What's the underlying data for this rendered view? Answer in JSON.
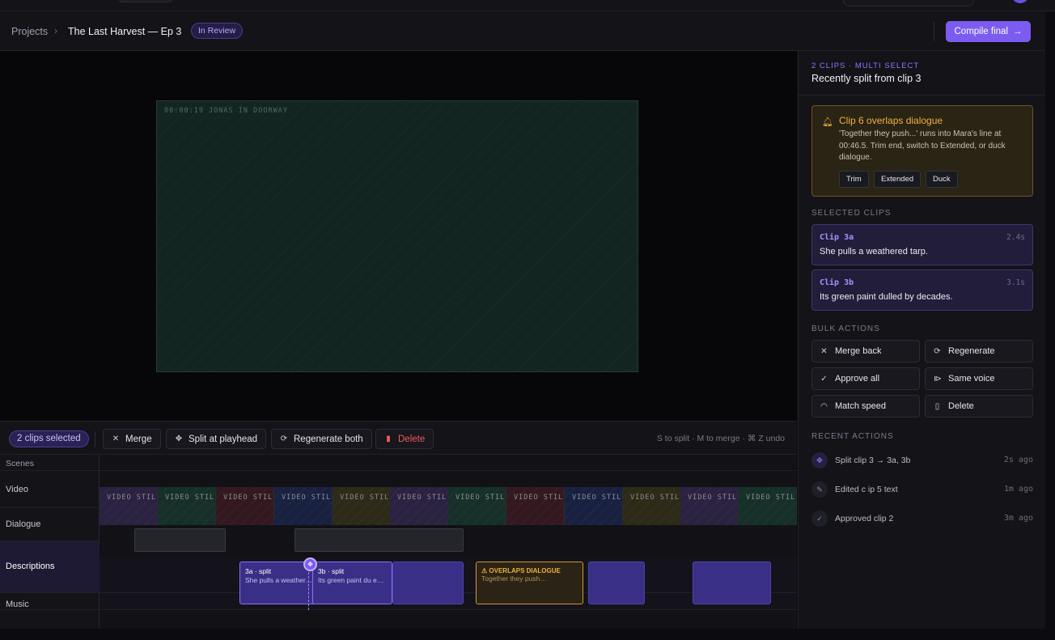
{
  "header": {
    "breadcrumb_root": "Projects",
    "breadcrumb_chevron": "›",
    "project_title": "The Last Harvest — Ep 3",
    "status": "In Review",
    "compile_label": "Compile final",
    "compile_arrow": "→"
  },
  "preview": {
    "timestamp": "00:00:19  JONAS IN DOORWAY"
  },
  "toolbar": {
    "selection_count": "2 clips selected",
    "merge_label": "Merge",
    "split_label": "Split at playhead",
    "regenerate_label": "Regenerate both",
    "delete_label": "Delete",
    "hint": "S to split · M to merge · ⌘ Z undo"
  },
  "timeline": {
    "tracks": [
      "Scenes",
      "Video",
      "Dialogue",
      "Descriptions",
      "Music"
    ],
    "still_label": "VIDEO STILL",
    "clips": [
      {
        "title": "3a · split",
        "sub": "She pulls a weather…"
      },
      {
        "title": "3b · split",
        "sub": "Its green paint du  e…"
      },
      {
        "title": "⚠ OVERLAPS DIALOGUE",
        "sub": "Together they push…"
      }
    ]
  },
  "panel": {
    "eyebrow": "2 CLIPS · MULTI SELECT",
    "title": "Recently split from clip 3",
    "warning": {
      "title": "Clip 6 overlaps dialogue",
      "body": "'Together they push...' runs into Mara's line at 00:46.5. Trim end, switch to Extended, or duck dialogue.",
      "actions": [
        "Trim",
        "Extended",
        "Duck"
      ]
    },
    "selected_label": "SELECTED CLIPS",
    "selected": [
      {
        "id": "Clip 3a",
        "duration": "2.4s",
        "text": "She pulls a weathered tarp."
      },
      {
        "id": "Clip 3b",
        "duration": "3.1s",
        "text": "Its green paint dulled by decades."
      }
    ],
    "bulk_label": "BULK ACTIONS",
    "bulk": [
      {
        "label": "Merge back",
        "icon": "merge-icon"
      },
      {
        "label": "Regenerate",
        "icon": "refresh-icon"
      },
      {
        "label": "Approve all",
        "icon": "check-icon"
      },
      {
        "label": "Same voice",
        "icon": "voice-icon"
      },
      {
        "label": "Match speed",
        "icon": "gauge-icon"
      },
      {
        "label": "Delete",
        "icon": "trash-icon"
      }
    ],
    "recent_label": "RECENT ACTIONS",
    "recent": [
      {
        "text": "Split clip 3 → 3a, 3b",
        "time": "2s ago"
      },
      {
        "text": "Edited c ip 5 text",
        "time": "1m ago"
      },
      {
        "text": "Approved clip 2",
        "time": "3m ago"
      }
    ]
  },
  "colors": {
    "accent": "#7c5cf0",
    "warning": "#f0b23c",
    "danger": "#f05c5c"
  }
}
